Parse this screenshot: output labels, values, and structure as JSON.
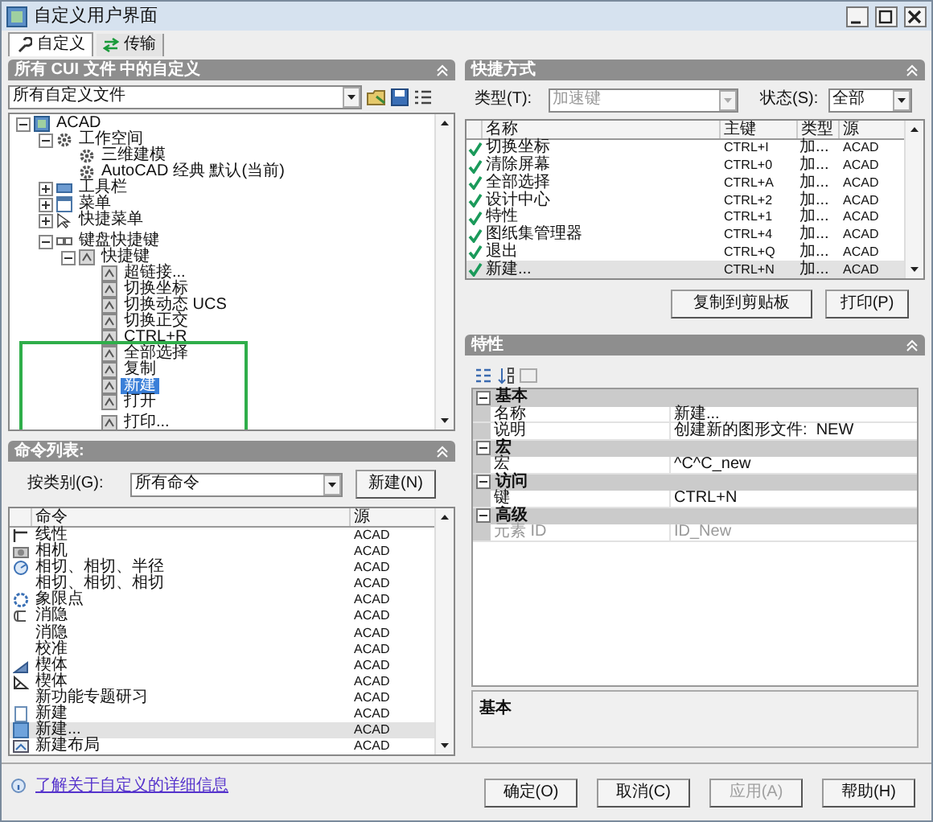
{
  "window": {
    "title": "自定义用户界面"
  },
  "tabs": [
    {
      "label": "自定义",
      "selected": true,
      "kind": "wrench"
    },
    {
      "label": "传输",
      "selected": false,
      "kind": "transfer"
    }
  ],
  "customizations_panel": {
    "title": "所有 CUI 文件 中的自定义",
    "file_select": "所有自定义文件",
    "tree": [
      {
        "label": "ACAD",
        "kind": "acad",
        "expanded": true,
        "selected": false,
        "children": [
          {
            "label": "工作空间",
            "kind": "gear",
            "expanded": true,
            "selected": false,
            "children": [
              {
                "label": "三维建模",
                "kind": "gear",
                "selected": false
              },
              {
                "label": "AutoCAD 经典 默认(当前)",
                "kind": "gear",
                "selected": false
              }
            ]
          },
          {
            "label": "工具栏",
            "kind": "toolbar",
            "expanded": false,
            "selected": false
          },
          {
            "label": "菜单",
            "kind": "menu",
            "expanded": false,
            "selected": false
          },
          {
            "label": "快捷菜单",
            "kind": "cursor",
            "expanded": false,
            "selected": false
          },
          {
            "label": "键盘快捷键",
            "kind": "keyboard",
            "expanded": true,
            "selected": false,
            "children": [
              {
                "label": "快捷键",
                "kind": "key",
                "expanded": true,
                "selected": false,
                "children": [
                  {
                    "label": "超链接...",
                    "kind": "key",
                    "selected": false
                  },
                  {
                    "label": "切换坐标",
                    "kind": "key",
                    "selected": false
                  },
                  {
                    "label": "切换动态 UCS",
                    "kind": "key",
                    "selected": false
                  },
                  {
                    "label": "切换正交",
                    "kind": "key",
                    "selected": false
                  },
                  {
                    "label": "CTRL+R",
                    "kind": "key",
                    "selected": false
                  },
                  {
                    "label": "全部选择",
                    "kind": "key",
                    "selected": false
                  },
                  {
                    "label": "复制",
                    "kind": "key",
                    "selected": false
                  },
                  {
                    "label": "新建",
                    "kind": "key",
                    "selected": true
                  },
                  {
                    "label": "打开",
                    "kind": "key",
                    "selected": false
                  },
                  {
                    "label": "打印...",
                    "kind": "key",
                    "selected": false
                  }
                ]
              }
            ]
          }
        ]
      }
    ]
  },
  "command_list": {
    "title": "命令列表:",
    "filter_label": "按类别(G):",
    "filter_value": "所有命令",
    "new_button": "新建(N)",
    "columns": [
      "命令",
      "源"
    ],
    "rows": [
      {
        "name": "线性",
        "kind": "linear",
        "source": "ACAD",
        "selected": false
      },
      {
        "name": "相机",
        "kind": "camera",
        "source": "ACAD",
        "selected": false
      },
      {
        "name": "相切、相切、半径",
        "kind": "tangent",
        "source": "ACAD",
        "selected": false
      },
      {
        "name": "相切、相切、相切",
        "kind": "none",
        "source": "ACAD",
        "selected": false
      },
      {
        "name": "象限点",
        "kind": "quadrant",
        "source": "ACAD",
        "selected": false
      },
      {
        "name": "消隐",
        "kind": "hide",
        "source": "ACAD",
        "selected": false
      },
      {
        "name": "消隐",
        "kind": "none",
        "source": "ACAD",
        "selected": false
      },
      {
        "name": "校准",
        "kind": "none",
        "source": "ACAD",
        "selected": false
      },
      {
        "name": "楔体",
        "kind": "wedge",
        "source": "ACAD",
        "selected": false
      },
      {
        "name": "楔体",
        "kind": "wedge2",
        "source": "ACAD",
        "selected": false
      },
      {
        "name": "新功能专题研习",
        "kind": "none",
        "source": "ACAD",
        "selected": false
      },
      {
        "name": "新建",
        "kind": "doc",
        "source": "ACAD",
        "selected": false
      },
      {
        "name": "新建...",
        "kind": "docblue",
        "source": "ACAD",
        "selected": true
      },
      {
        "name": "新建布局",
        "kind": "layout",
        "source": "ACAD",
        "selected": false
      }
    ]
  },
  "help_link": "了解关于自定义的详细信息",
  "shortcuts_panel": {
    "title": "快捷方式",
    "type_label": "类型(T):",
    "type_value": "加速键",
    "type_disabled": true,
    "status_label": "状态(S):",
    "status_value": "全部",
    "columns": [
      "名称",
      "主键",
      "类型",
      "源"
    ],
    "rows": [
      {
        "name": "切换坐标",
        "key": "CTRL+I",
        "type": "加...",
        "source": "ACAD",
        "selected": false
      },
      {
        "name": "清除屏幕",
        "key": "CTRL+0",
        "type": "加...",
        "source": "ACAD",
        "selected": false
      },
      {
        "name": "全部选择",
        "key": "CTRL+A",
        "type": "加...",
        "source": "ACAD",
        "selected": false
      },
      {
        "name": "设计中心",
        "key": "CTRL+2",
        "type": "加...",
        "source": "ACAD",
        "selected": false
      },
      {
        "name": "特性",
        "key": "CTRL+1",
        "type": "加...",
        "source": "ACAD",
        "selected": false
      },
      {
        "name": "图纸集管理器",
        "key": "CTRL+4",
        "type": "加...",
        "source": "ACAD",
        "selected": false
      },
      {
        "name": "退出",
        "key": "CTRL+Q",
        "type": "加...",
        "source": "ACAD",
        "selected": false
      },
      {
        "name": "新建...",
        "key": "CTRL+N",
        "type": "加...",
        "source": "ACAD",
        "selected": true
      }
    ],
    "buttons": [
      "复制到剪贴板",
      "打印(P)"
    ]
  },
  "properties_panel": {
    "title": "特性",
    "categories": [
      {
        "name": "基本",
        "expanded": true,
        "rows": [
          {
            "name": "名称",
            "value": "新建...",
            "disabled": false
          },
          {
            "name": "说明",
            "value": "创建新的图形文件:  NEW",
            "disabled": false
          }
        ]
      },
      {
        "name": "宏",
        "expanded": true,
        "rows": [
          {
            "name": "宏",
            "value": "^C^C_new",
            "disabled": false
          }
        ]
      },
      {
        "name": "访问",
        "expanded": true,
        "rows": [
          {
            "name": "键",
            "value": "CTRL+N",
            "disabled": false
          }
        ]
      },
      {
        "name": "高级",
        "expanded": true,
        "rows": [
          {
            "name": "元素 ID",
            "value": "ID_New",
            "disabled": true
          }
        ]
      }
    ],
    "description": "基本"
  },
  "footer_buttons": [
    {
      "label": "确定(O)",
      "disabled": false
    },
    {
      "label": "取消(C)",
      "disabled": false
    },
    {
      "label": "应用(A)",
      "disabled": true
    },
    {
      "label": "帮助(H)",
      "disabled": false
    }
  ]
}
